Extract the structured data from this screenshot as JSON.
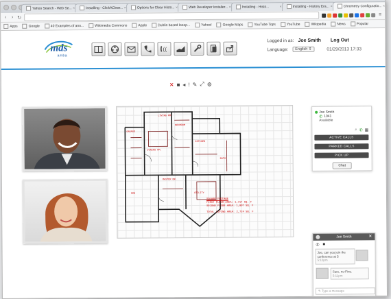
{
  "browser": {
    "tabs": [
      {
        "label": "Yahoo Search - Web Se..."
      },
      {
        "label": "Installing - ClickAClear..."
      },
      {
        "label": "Options for Clear Histo..."
      },
      {
        "label": "Web Developer Installer..."
      },
      {
        "label": "Installing - Histo..."
      },
      {
        "label": "Installing - History Era..."
      },
      {
        "label": "Chrometry Configuratio..."
      }
    ],
    "bookmarks": [
      "Apps",
      "Google",
      "40 Examples of ano...",
      "Wikimedia Commons",
      "Apple",
      "Dublin based looop...",
      "Yahoo!",
      "Google Maps",
      "YouTube Tops",
      "YouTube",
      "Wikipedia",
      "News",
      "Popular"
    ],
    "ext_colors": [
      "#333333",
      "#f2a02a",
      "#d33",
      "#3a8f3a",
      "#e7c000",
      "#555555",
      "#1a73e8",
      "#e04040",
      "#6a3",
      "#888888"
    ]
  },
  "app": {
    "logo": {
      "brand": "mds",
      "sub": "amba"
    },
    "toolbar_icons": [
      "layout-icon",
      "film-reel-icon",
      "envelope-icon",
      "phone-handset-icon",
      "forward-call-icon",
      "chart-icon",
      "wrench-icon",
      "document-icon",
      "share-icon"
    ],
    "user": {
      "logged_label": "Logged in as:",
      "name": "Joe Smith",
      "logout": "Log Out",
      "language_label": "Language:",
      "language_value": "English",
      "datetime": "01/29/2013 17:33"
    },
    "floorplan": {
      "room_labels": [
        "LIVING RM.",
        "GARAGE",
        "BEDROOM",
        "KITCHEN",
        "DINING RM.",
        "BATH",
        "MASTER BR.",
        "DEN",
        "UTILITY"
      ],
      "info_lines": [
        "SQUARE FOOTAGE",
        "FIRST FLOOR AREA: 1,717 SQ. F",
        "SECOND FLOOR AREA: 1,007 SQ. F",
        "",
        "TOTAL LIVING AREA: 2,724 SQ. F"
      ]
    },
    "presence": {
      "name": "Joe Smith",
      "extension": "1041",
      "status": "Available",
      "buttons": [
        "ACTIVE CALLS",
        "PARKED CALLS",
        "PICK UP"
      ],
      "chat_button": "Chat"
    },
    "chat": {
      "header": "Joe Smith",
      "messages": [
        {
          "text": "Joe, can you join the conference at 5",
          "time": "5:10pm"
        },
        {
          "text": "Sure, no-Fine.",
          "time": "5:11pm"
        }
      ],
      "placeholder": "Type a message"
    }
  }
}
